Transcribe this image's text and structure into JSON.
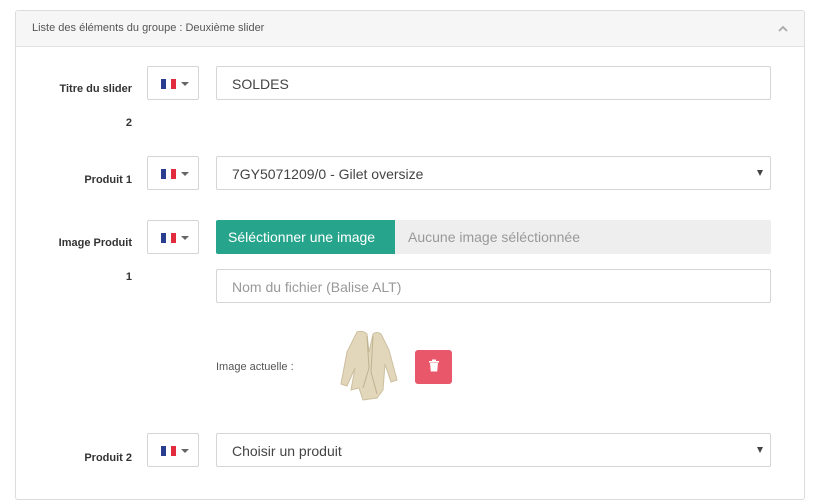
{
  "panel": {
    "title": "Liste des éléments du groupe : Deuxième slider"
  },
  "rows": {
    "titre": {
      "label_line1": "Titre du slider",
      "label_line2": "2",
      "value": "SOLDES"
    },
    "produit1": {
      "label": "Produit 1",
      "selected": "7GY5071209/0 - Gilet oversize"
    },
    "image1": {
      "label_line1": "Image Produit",
      "label_line2": "1",
      "button_label": "Séléctionner une image",
      "status": "Aucune image séléctionnée",
      "alt_placeholder": "Nom du fichier (Balise ALT)",
      "current_label": "Image actuelle :"
    },
    "produit2": {
      "label": "Produit 2",
      "selected": "Choisir un produit"
    }
  },
  "icons": {
    "language": "french-flag-icon",
    "collapse": "chevron-up-icon",
    "delete": "trash-icon"
  },
  "colors": {
    "upload_button": "#27a58c",
    "delete_button": "#e9586a",
    "flag_blue": "#2a3e8f",
    "flag_red": "#e22b3c"
  }
}
